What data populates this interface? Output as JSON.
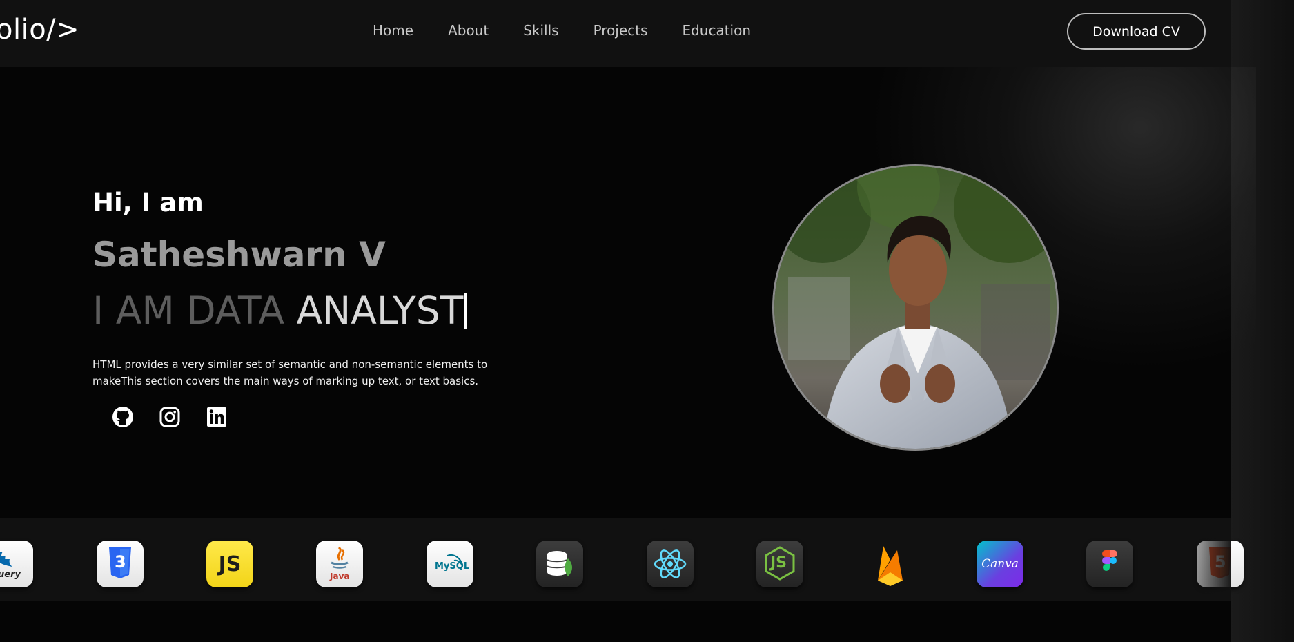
{
  "header": {
    "logo": "olio/>",
    "nav": [
      {
        "label": "Home"
      },
      {
        "label": "About"
      },
      {
        "label": "Skills"
      },
      {
        "label": "Projects"
      },
      {
        "label": "Education"
      }
    ],
    "cv_button": "Download CV"
  },
  "hero": {
    "greeting": "Hi, I am",
    "name": "Satheshwarn V",
    "role_dim": "I AM DATA",
    "role_bright": " ANALYST",
    "description_line1": "HTML provides a very similar set of semantic and non-semantic elements to",
    "description_line2": "makeThis section covers the main ways of marking up text, or text basics.",
    "socials": [
      "github-icon",
      "instagram-icon",
      "linkedin-icon"
    ]
  },
  "tech_strip": {
    "tiles": [
      {
        "icon": "jquery-icon",
        "text": "Query"
      },
      {
        "icon": "css3-icon",
        "text": "3"
      },
      {
        "icon": "javascript-icon",
        "text": "JS"
      },
      {
        "icon": "java-icon",
        "text": "Java"
      },
      {
        "icon": "mysql-icon",
        "text": "MySQL"
      },
      {
        "icon": "mongodb-icon"
      },
      {
        "icon": "react-icon"
      },
      {
        "icon": "nodejs-icon",
        "text": "JS"
      },
      {
        "icon": "firebase-icon"
      },
      {
        "icon": "canva-icon",
        "text": "Canva"
      },
      {
        "icon": "figma-icon"
      },
      {
        "icon": "html5-icon",
        "text": "5"
      }
    ]
  },
  "colors": {
    "background": "#050505",
    "header": "#111111",
    "name_gray": "#9a9a9a",
    "js_yellow": "#f7df1e",
    "css_blue": "#2965f1",
    "react_cyan": "#61dafb"
  }
}
